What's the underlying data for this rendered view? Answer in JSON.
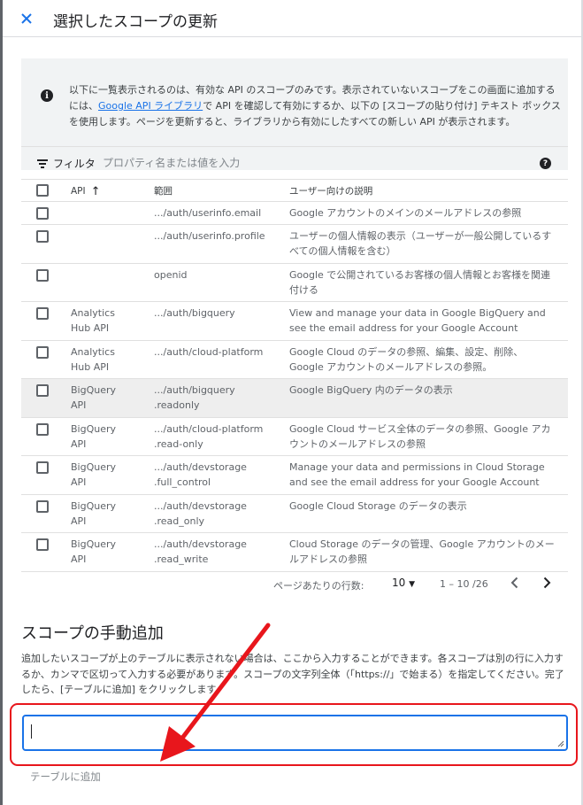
{
  "header": {
    "title": "選択したスコープの更新",
    "close_icon": "close-icon"
  },
  "info": {
    "icon": "info-icon",
    "text_before_link": "以下に一覧表示されるのは、有効な API のスコープのみです。表示されていないスコープをこの画面に追加するには、",
    "link": "Google API ライブラリ",
    "text_after_link": "で API を確認して有効にするか、以下の [スコープの貼り付け] テキスト ボックスを使用します。ページを更新すると、ライブラリから有効にしたすべての新しい API が表示されます。"
  },
  "filter": {
    "label": "フィルタ",
    "placeholder": "プロパティ名または値を入力",
    "icon": "filter-icon",
    "help_icon": "help-icon"
  },
  "table": {
    "headers": {
      "api": "API",
      "scope": "範囲",
      "description": "ユーザー向けの説明"
    },
    "sort_icon": "arrow-upward-icon",
    "rows": [
      {
        "api": "",
        "scope": ".../auth/userinfo.email",
        "description": "Google アカウントのメインのメールアドレスの参照"
      },
      {
        "api": "",
        "scope": ".../auth/userinfo.profile",
        "description": "ユーザーの個人情報の表示（ユーザーが一般公開しているすべての個人情報を含む）"
      },
      {
        "api": "",
        "scope": "openid",
        "description": "Google で公開されているお客様の個人情報とお客様を関連付ける"
      },
      {
        "api": "Analytics Hub API",
        "scope": ".../auth/bigquery",
        "description": "View and manage your data in Google BigQuery and see the email address for your Google Account"
      },
      {
        "api": "Analytics Hub API",
        "scope": ".../auth/cloud-platform",
        "description": "Google Cloud のデータの参照、編集、設定、削除、Google アカウントのメールアドレスの参照。"
      },
      {
        "api": "BigQuery API",
        "scope": ".../auth/bigquery .readonly",
        "description": "Google BigQuery 内のデータの表示"
      },
      {
        "api": "BigQuery API",
        "scope": ".../auth/cloud-platform .read-only",
        "description": "Google Cloud サービス全体のデータの参照、Google アカウントのメールアドレスの参照"
      },
      {
        "api": "BigQuery API",
        "scope": ".../auth/devstorage .full_control",
        "description": "Manage your data and permissions in Cloud Storage and see the email address for your Google Account"
      },
      {
        "api": "BigQuery API",
        "scope": ".../auth/devstorage .read_only",
        "description": "Google Cloud Storage のデータの表示"
      },
      {
        "api": "BigQuery API",
        "scope": ".../auth/devstorage .read_write",
        "description": "Cloud Storage のデータの管理、Google アカウントのメールアドレスの参照"
      }
    ]
  },
  "pagination": {
    "rows_per_page_label": "ページあたりの行数:",
    "rows_per_page_value": "10",
    "range": "1 – 10 /26",
    "prev_icon": "chevron-left-icon",
    "next_icon": "chevron-right-icon"
  },
  "manual": {
    "title": "スコープの手動追加",
    "description": "追加したいスコープが上のテーブルに表示されない場合は、ここから入力することができます。各スコープは別の行に入力するか、カンマで区切って入力する必要があります。スコープの文字列全体（「https://」で始まる）を指定してください。完了したら、[テーブルに追加] をクリックします。",
    "input_value": "",
    "add_button": "テーブルに追加"
  },
  "annotation": {
    "arrow_color": "#e8161c",
    "frame_color": "#e8161c"
  },
  "colors": {
    "accent": "#1a73e8",
    "info_bg": "#f1f3f4",
    "highlight_row": "#eeeeee"
  }
}
